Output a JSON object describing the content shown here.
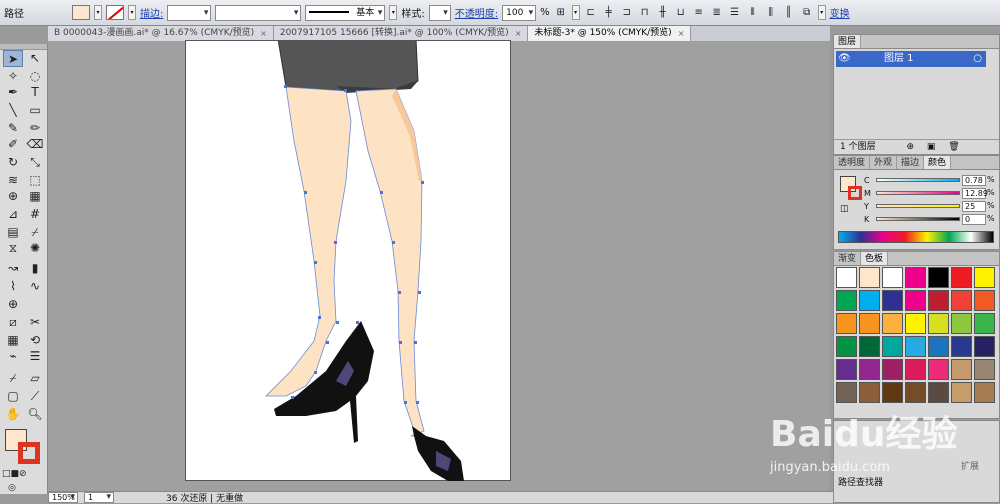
{
  "control_bar": {
    "object_type": "路径",
    "stroke_label": "描边:",
    "stroke_style": "基本",
    "style_label": "样式:",
    "opacity_label": "不透明度:",
    "opacity_value": "100",
    "opacity_unit": "%",
    "transform_label": "变换",
    "fill_color": "#fbe6cf"
  },
  "tabs": [
    {
      "label": "B 0000043-漫画画.ai* @ 16.67% (CMYK/预览)",
      "close": "×"
    },
    {
      "label": "2007917105 15666 [转换].ai* @ 100% (CMYK/预览)",
      "close": "×"
    },
    {
      "label": "未标题-3* @ 150% (CMYK/预览)",
      "close": "×"
    }
  ],
  "status_bar": {
    "zoom": "150%",
    "page": "1",
    "info": "36 次还原 | 无重做"
  },
  "layers_panel": {
    "title": "图层",
    "layer_name": "图层 1",
    "count": "1 个图层"
  },
  "color_panel": {
    "tabs": [
      "透明度",
      "外观",
      "描边",
      "颜色"
    ],
    "channels": [
      {
        "name": "C",
        "value": "0.78",
        "unit": "%"
      },
      {
        "name": "M",
        "value": "12.89",
        "unit": "%"
      },
      {
        "name": "Y",
        "value": "25",
        "unit": "%"
      },
      {
        "name": "K",
        "value": "0",
        "unit": "%"
      }
    ]
  },
  "swatches_panel": {
    "tabs": [
      "渐变",
      "色板"
    ],
    "colors": [
      "#ffffff",
      "#fde6cc",
      "#ffffff",
      "#ec008c",
      "#000000",
      "#ed1c24",
      "#fff200",
      "#00a651",
      "#00aeef",
      "#2e3192",
      "#ec008c",
      "#be1e2d",
      "#ef4136",
      "#f15a24",
      "#f7941d",
      "#f7931e",
      "#fbb040",
      "#fff200",
      "#d7df23",
      "#8dc63f",
      "#39b54a",
      "#009444",
      "#006838",
      "#00a79d",
      "#27aae1",
      "#1c75bc",
      "#2b388f",
      "#262262",
      "#662d91",
      "#92278f",
      "#9e1f63",
      "#da1c5c",
      "#ee2a7b",
      "#c49a6c",
      "#998675",
      "#736357",
      "#8b5e3c",
      "#603913",
      "#754c29",
      "#594a42",
      "#c69c6d",
      "#a67c52",
      "#8c6239",
      "#754c24",
      "#603813",
      "#42210b",
      "#2e1a0c",
      "#4d4d4d"
    ]
  },
  "finder_panel": {
    "title": "路径查找器",
    "expand": "扩展"
  },
  "watermark": {
    "text": "Baidu经验",
    "url": "jingyan.baidu.com"
  }
}
